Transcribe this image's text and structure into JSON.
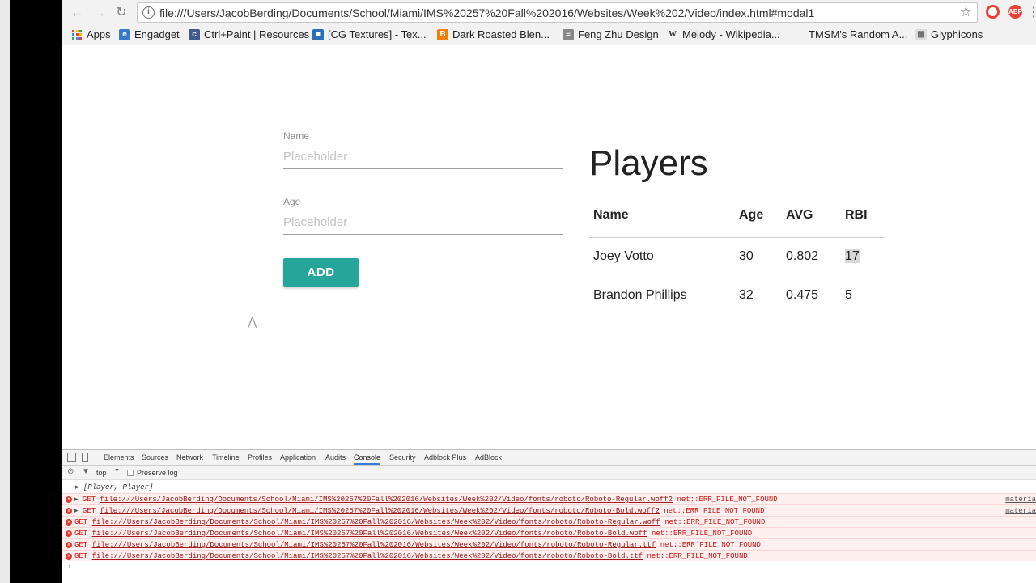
{
  "browser": {
    "url": "file:///Users/JacobBerding/Documents/School/Miami/IMS%20257%20Fall%202016/Websites/Week%202/Video/index.html#modal1",
    "bookmarks": [
      {
        "label": "Apps"
      },
      {
        "label": "Engadget"
      },
      {
        "label": "Ctrl+Paint | Resources"
      },
      {
        "label": "[CG Textures] - Tex..."
      },
      {
        "label": "Dark Roasted Blen..."
      },
      {
        "label": "Feng Zhu Design"
      },
      {
        "label": "Melody - Wikipedia..."
      },
      {
        "label": "TMSM's Random A..."
      },
      {
        "label": "Glyphicons"
      }
    ],
    "ext_abp": "ABP"
  },
  "form": {
    "name_label": "Name",
    "name_placeholder": "Placeholder",
    "age_label": "Age",
    "age_placeholder": "Placeholder",
    "add_button": "ADD"
  },
  "players": {
    "title": "Players",
    "columns": [
      "Name",
      "Age",
      "AVG",
      "RBI"
    ],
    "rows": [
      [
        "Joey Votto",
        "30",
        "0.802",
        "17"
      ],
      [
        "Brandon Phillips",
        "32",
        "0.475",
        "5"
      ]
    ]
  },
  "devtools": {
    "tabs": [
      "Elements",
      "Sources",
      "Network",
      "Timeline",
      "Profiles",
      "Application",
      "Audits",
      "Console",
      "Security",
      "Adblock Plus",
      "AdBlock"
    ],
    "active_tab": "Console",
    "context": "top",
    "preserve_log": "Preserve log",
    "log_output": "[Player, Player]",
    "errors": [
      {
        "method": "GET",
        "url": "file:///Users/JacobBerding/Documents/School/Miami/IMS%20257%20Fall%202016/Websites/Week%202/Video/fonts/roboto/Roboto-Regular.woff2",
        "error": "net::ERR_FILE_NOT_FOUND",
        "source": "materia",
        "expand": true
      },
      {
        "method": "GET",
        "url": "file:///Users/JacobBerding/Documents/School/Miami/IMS%20257%20Fall%202016/Websites/Week%202/Video/fonts/roboto/Roboto-Bold.woff2",
        "error": "net::ERR_FILE_NOT_FOUND",
        "source": "materia",
        "expand": true
      },
      {
        "method": "GET",
        "url": "file:///Users/JacobBerding/Documents/School/Miami/IMS%20257%20Fall%202016/Websites/Week%202/Video/fonts/roboto/Roboto-Regular.woff",
        "error": "net::ERR_FILE_NOT_FOUND",
        "source": "",
        "expand": false
      },
      {
        "method": "GET",
        "url": "file:///Users/JacobBerding/Documents/School/Miami/IMS%20257%20Fall%202016/Websites/Week%202/Video/fonts/roboto/Roboto-Bold.woff",
        "error": "net::ERR_FILE_NOT_FOUND",
        "source": "",
        "expand": false
      },
      {
        "method": "GET",
        "url": "file:///Users/JacobBerding/Documents/School/Miami/IMS%20257%20Fall%202016/Websites/Week%202/Video/fonts/roboto/Roboto-Regular.ttf",
        "error": "net::ERR_FILE_NOT_FOUND",
        "source": "",
        "expand": false
      },
      {
        "method": "GET",
        "url": "file:///Users/JacobBerding/Documents/School/Miami/IMS%20257%20Fall%202016/Websites/Week%202/Video/fonts/roboto/Roboto-Bold.ttf",
        "error": "net::ERR_FILE_NOT_FOUND",
        "source": "",
        "expand": false
      }
    ]
  },
  "colors": {
    "accent": "#26a69a",
    "error": "#d41414"
  }
}
